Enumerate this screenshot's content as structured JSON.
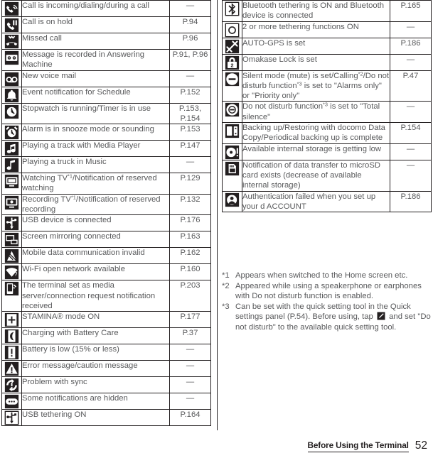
{
  "page": {
    "footer_title": "Before Using the Terminal",
    "page_number": "52"
  },
  "left_table": {
    "rows": [
      {
        "icon": "call-active-icon",
        "desc": "Call is incoming/dialing/during a call",
        "page": "—"
      },
      {
        "icon": "call-on-hold-icon",
        "desc": "Call is on hold",
        "page": "P.94"
      },
      {
        "icon": "missed-call-icon",
        "desc": "Missed call",
        "page": "P.96"
      },
      {
        "icon": "answering-machine-icon",
        "desc": "Message is recorded in Answering Machine",
        "page": "P.91, P.96"
      },
      {
        "icon": "voicemail-icon",
        "desc": "New voice mail",
        "page": "—"
      },
      {
        "icon": "schedule-bell-icon",
        "desc": "Event notification for Schedule",
        "page": "P.152"
      },
      {
        "icon": "stopwatch-icon",
        "desc": "Stopwatch is running/Timer is in use",
        "page": "P.153,\nP.154"
      },
      {
        "icon": "alarm-clock-icon",
        "desc": "Alarm is in snooze mode or sounding",
        "page": "P.153"
      },
      {
        "icon": "media-player-icon",
        "desc": "Playing a track with Media Player",
        "page": "P.147"
      },
      {
        "icon": "music-note-icon",
        "desc": "Playing a truck in Music",
        "page": "—"
      },
      {
        "icon": "tv-watching-icon",
        "desc": "Watching TV*1/Notification of reserved watching",
        "desc_pre": "Watching TV",
        "desc_sup": "1",
        "desc_post": "/Notification of reserved watching",
        "page": "P.129"
      },
      {
        "icon": "tv-recording-icon",
        "desc": "Recording TV*1/Notification of reserved recording",
        "desc_pre": "Recording TV",
        "desc_sup": "1",
        "desc_post": "/Notification of reserved recording",
        "page": "P.132"
      },
      {
        "icon": "usb-device-icon",
        "desc": "USB device is connected",
        "page": "P.176"
      },
      {
        "icon": "screen-mirroring-icon",
        "desc": "Screen mirroring connected",
        "page": "P.163"
      },
      {
        "icon": "mobile-data-off-icon",
        "desc": "Mobile data communication invalid",
        "page": "P.162"
      },
      {
        "icon": "wifi-open-network-icon",
        "desc": "Wi-Fi open network available",
        "page": "P.160"
      },
      {
        "icon": "media-server-icon",
        "desc": "The terminal set as media server/connection request notification received",
        "page": "P.203"
      },
      {
        "icon": "stamina-mode-icon",
        "desc": "STAMINA® mode ON",
        "page": "P.177"
      },
      {
        "icon": "battery-care-icon",
        "desc": "Charging with Battery Care",
        "page": "P.37"
      },
      {
        "icon": "battery-low-icon",
        "desc": "Battery is low (15% or less)",
        "page": "—"
      },
      {
        "icon": "warning-triangle-icon",
        "desc": "Error message/caution message",
        "page": "—"
      },
      {
        "icon": "sync-problem-icon",
        "desc": "Problem with sync",
        "page": "—"
      },
      {
        "icon": "hidden-notifications-icon",
        "desc": "Some notifications are hidden",
        "page": "—"
      },
      {
        "icon": "usb-tethering-icon",
        "desc": "USB tethering ON",
        "page": "P.164"
      }
    ]
  },
  "right_table": {
    "rows": [
      {
        "icon": "bluetooth-tethering-icon",
        "desc": "Bluetooth tethering is ON and Bluetooth device is connected",
        "page": "P.165"
      },
      {
        "icon": "multi-tethering-icon",
        "desc": "2 or more tethering functions ON",
        "page": "—"
      },
      {
        "icon": "auto-gps-icon",
        "desc": "AUTO-GPS is set",
        "page": "P.186"
      },
      {
        "icon": "omakase-lock-icon",
        "desc": "Omakase Lock is set",
        "page": "—"
      },
      {
        "icon": "silent-mode-icon",
        "desc": "Silent mode (mute) is set/Calling*2/Do not disturb function*3 is set to \"Alarms only\" or \"Priority only\"",
        "seg": [
          "Silent mode (mute) is set/Calling",
          "2",
          "/",
          "Do not disturb function",
          "3",
          " is set to \"Alarms only\" or \"Priority only\""
        ],
        "page": "P.47"
      },
      {
        "icon": "total-silence-icon",
        "desc": "Do not disturb function*3 is set to \"Total silence\"",
        "seg2": [
          "Do not disturb function",
          "3",
          " is set to \"Total silence\""
        ],
        "page": "—"
      },
      {
        "icon": "docomo-data-copy-icon",
        "desc": "Backing up/Restoring with docomo Data Copy/Periodical backing up is complete",
        "page": "P.154"
      },
      {
        "icon": "storage-low-icon",
        "desc": "Available internal storage is getting low",
        "page": "—"
      },
      {
        "icon": "sd-card-transfer-icon",
        "desc": "Notification of data transfer to microSD card exists (decrease of available internal storage)",
        "page": "—"
      },
      {
        "icon": "auth-failed-icon",
        "desc": "Authentication failed when you set up your d ACCOUNT",
        "page": "P.186"
      }
    ]
  },
  "footnotes": [
    {
      "mark": "*1",
      "text": "Appears when switched to the Home screen etc."
    },
    {
      "mark": "*2",
      "text": "Appeared while using a speakerphone or earphones with Do not disturb function is enabled."
    },
    {
      "mark": "*3",
      "text_before": "Can be set with the quick setting tool in the Quick settings panel (P.54). Before using, tap ",
      "icon": "edit-pencil-icon",
      "text_after": " and set \"Do not disturb\" to the available quick setting tool."
    }
  ]
}
